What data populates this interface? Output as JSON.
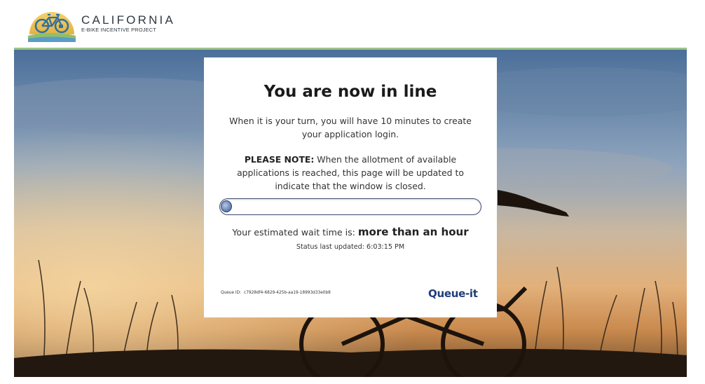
{
  "header": {
    "logo_title": "CALIFORNIA",
    "logo_subtitle": "E-BIKE INCENTIVE PROJECT",
    "logo_icon": "bicycle-sun-icon"
  },
  "card": {
    "title": "You are now in line",
    "intro": "When it is your turn, you will have 10 minutes to create your application login.",
    "note_label": "PLEASE NOTE:",
    "note_text": " When the allotment of available applications is reached, this page will be updated to indicate that the window is closed.",
    "progress": 0.02,
    "wait_label": "Your estimated wait time is: ",
    "wait_value": "more than an hour",
    "status_label": "Status last updated: ",
    "status_time": "6:03:15 PM",
    "queue_id_label": "Queue ID:",
    "queue_id_value": "c7928df4-6829-425b-aa19-18993d33e0b8",
    "brand": "Queue-it"
  },
  "colors": {
    "accent_green": "#9cc38a",
    "progress_border": "#3b4a6b",
    "queueit_blue": "#1f3d7a",
    "logo_gold": "#e8c35a",
    "logo_blue": "#3c7fb5"
  }
}
